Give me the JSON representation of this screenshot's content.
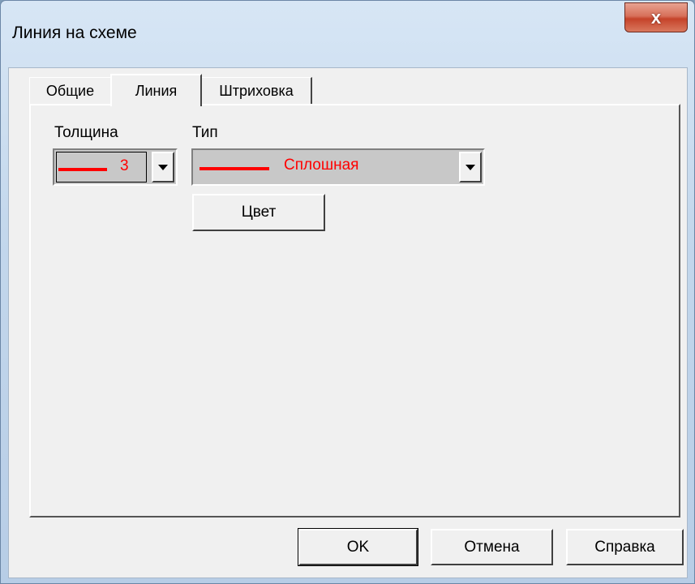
{
  "window": {
    "title": "Линия на схеме",
    "close_glyph": "x"
  },
  "tabs": [
    {
      "label": "Общие",
      "active": false
    },
    {
      "label": "Линия",
      "active": true
    },
    {
      "label": "Штриховка",
      "active": false
    }
  ],
  "line_tab": {
    "thickness_label": "Толщина",
    "thickness_value": "3",
    "type_label": "Тип",
    "type_value": "Сплошная",
    "color_button": "Цвет",
    "line_color": "#ff0000"
  },
  "footer": {
    "ok": "OK",
    "cancel": "Отмена",
    "help": "Справка"
  }
}
